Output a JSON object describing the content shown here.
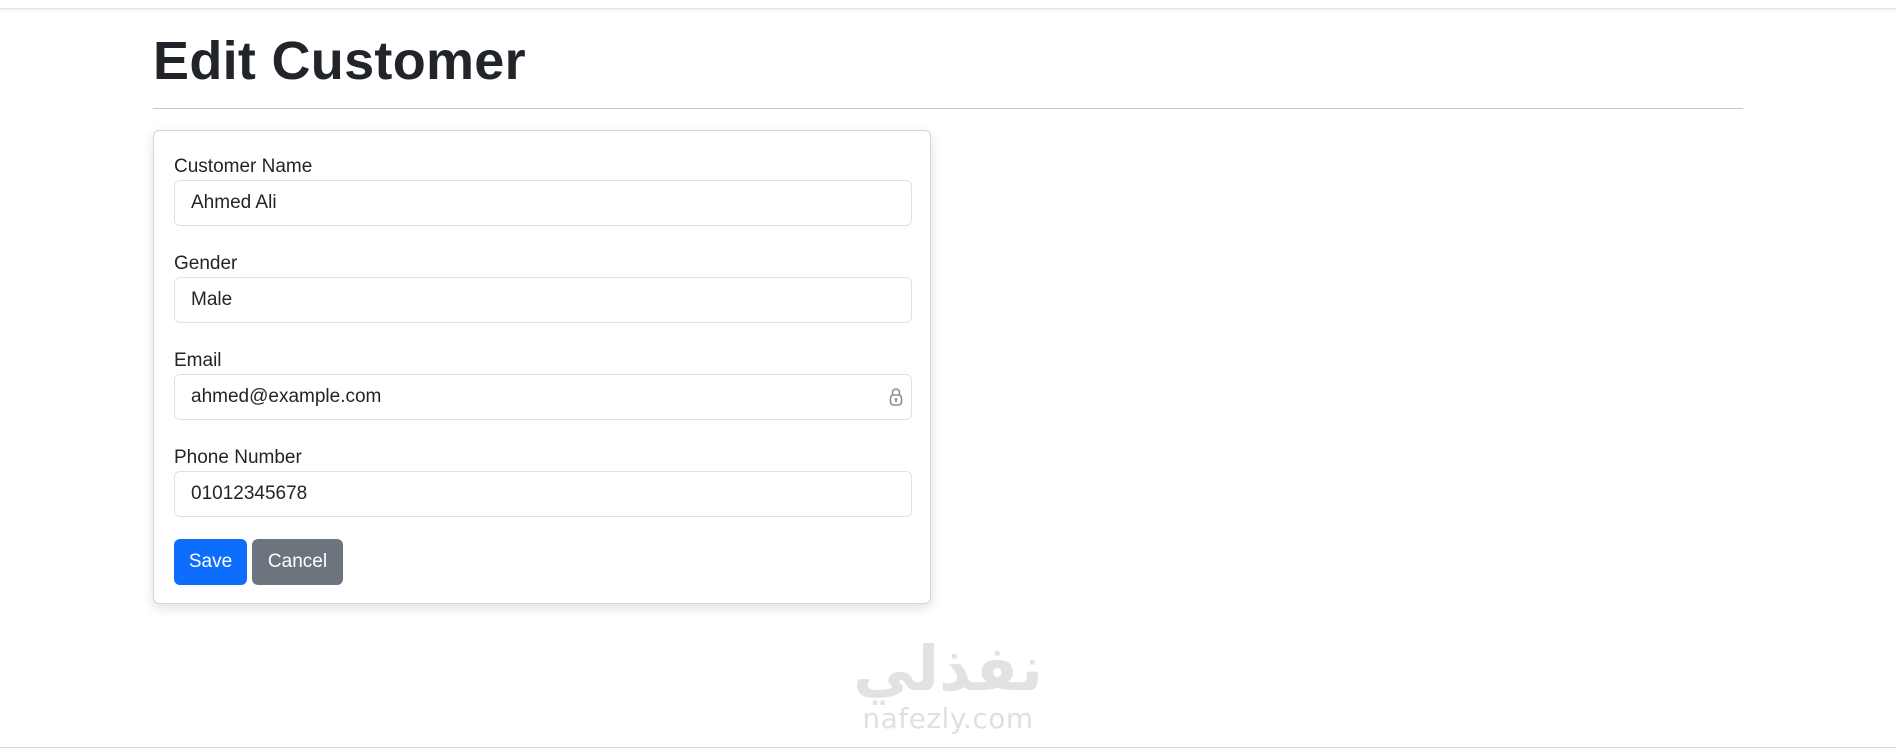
{
  "page": {
    "title": "Edit Customer"
  },
  "form": {
    "customer_name": {
      "label": "Customer Name",
      "value": "Ahmed Ali"
    },
    "gender": {
      "label": "Gender",
      "value": "Male"
    },
    "email": {
      "label": "Email",
      "value": "ahmed@example.com",
      "icon": "lock-icon"
    },
    "phone": {
      "label": "Phone Number",
      "value": "01012345678"
    }
  },
  "actions": {
    "save_label": "Save",
    "cancel_label": "Cancel"
  },
  "watermark": {
    "logo_text": "نفذلي",
    "url_text": "nafezly.com"
  },
  "colors": {
    "primary": "#0d6efd",
    "secondary": "#6c757d",
    "text": "#212529",
    "border": "#dee2e6"
  }
}
